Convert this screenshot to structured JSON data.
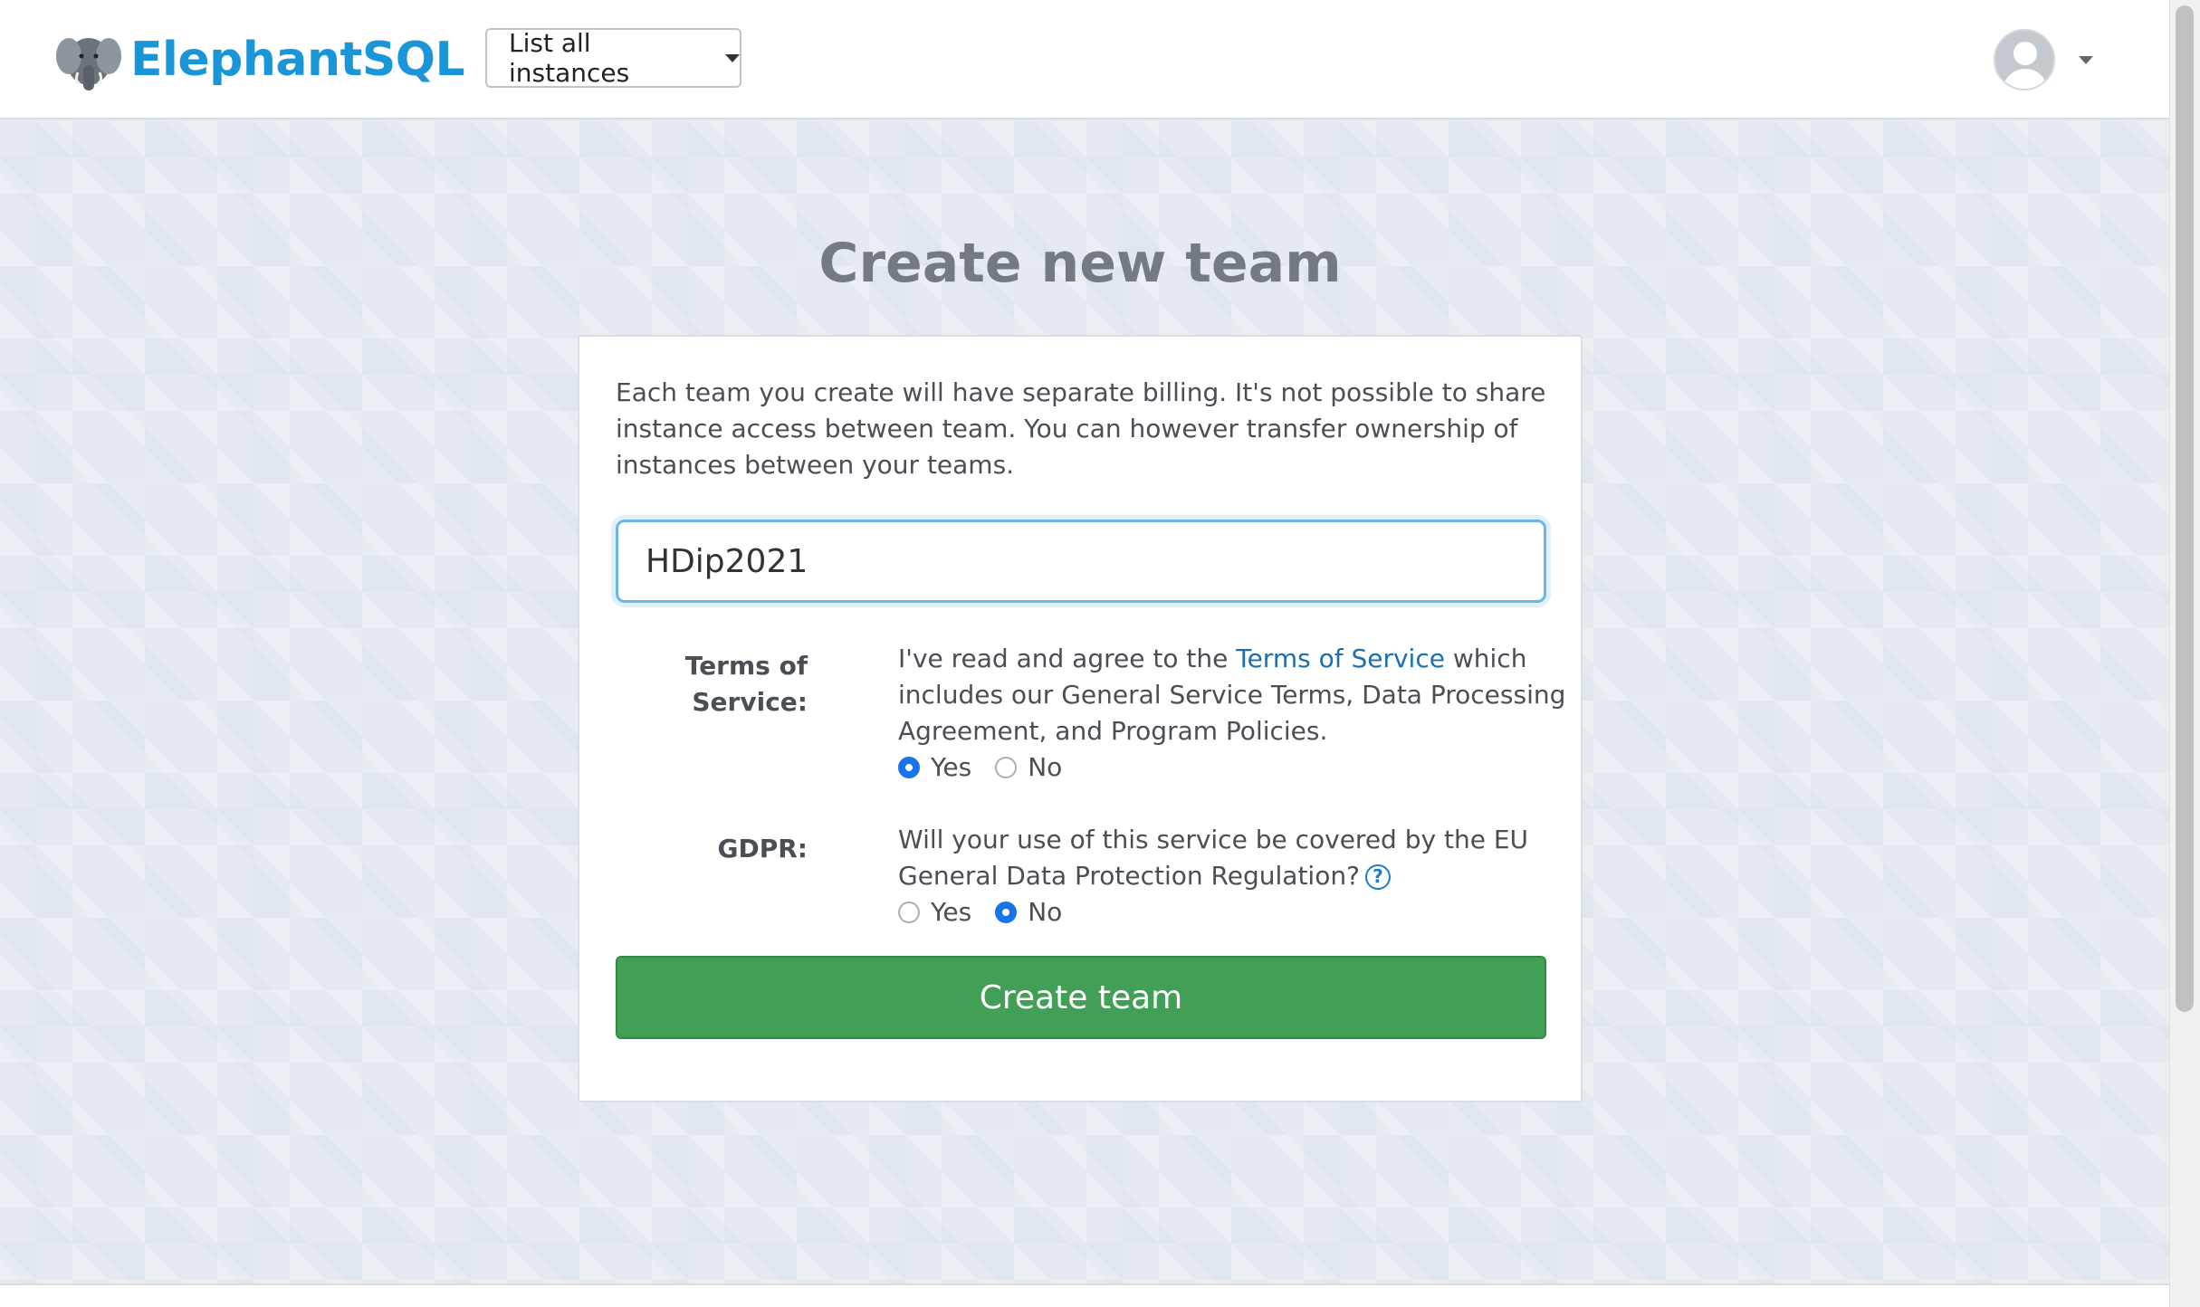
{
  "header": {
    "brand": "ElephantSQL",
    "instances_dropdown": "List all instances"
  },
  "main": {
    "title": "Create new team",
    "intro": "Each team you create will have separate billing. It's not possible to share instance access between team. You can however transfer ownership of instances between your teams.",
    "team_name_value": "HDip2021",
    "tos": {
      "label": "Terms of Service:",
      "text_before": "I've read and agree to the ",
      "link": "Terms of Service",
      "text_after": " which includes our General Service Terms, Data Processing Agreement, and Program Policies.",
      "options": [
        "Yes",
        "No"
      ],
      "selected": "Yes"
    },
    "gdpr": {
      "label": "GDPR:",
      "question": "Will your use of this service be covered by the EU General Data Protection Regulation?",
      "help_icon": "?",
      "options": [
        "Yes",
        "No"
      ],
      "selected": "No"
    },
    "create_button": "Create team"
  },
  "colors": {
    "brand": "#1a96d8",
    "primary_button": "#41a056",
    "link": "#1a6fae",
    "radio_checked": "#1a73e8"
  }
}
